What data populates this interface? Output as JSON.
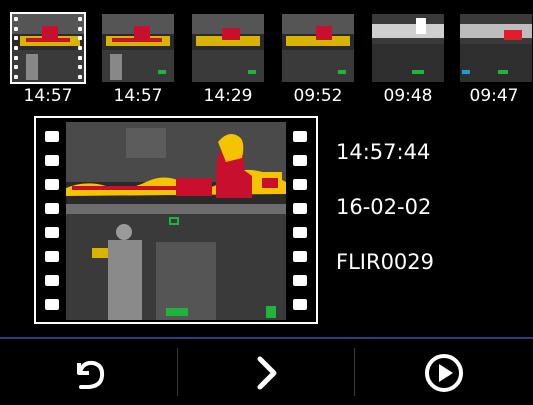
{
  "thumbnails": [
    {
      "time": "14:57",
      "selected": true
    },
    {
      "time": "14:57",
      "selected": false
    },
    {
      "time": "14:29",
      "selected": false
    },
    {
      "time": "09:52",
      "selected": false
    },
    {
      "time": "09:48",
      "selected": false
    },
    {
      "time": "09:47",
      "selected": false
    }
  ],
  "preview": {
    "time": "14:57:44",
    "date": "16-02-02",
    "filename": "FLIR0029"
  },
  "toolbar": {
    "back_icon": "undo-arrow-icon",
    "next_icon": "chevron-right-icon",
    "play_icon": "play-circle-icon"
  },
  "colors": {
    "background": "#000000",
    "text": "#ffffff",
    "separator": "#2b3f7a",
    "fire_hot": "#c8102e",
    "fire_warm": "#f5c400"
  }
}
